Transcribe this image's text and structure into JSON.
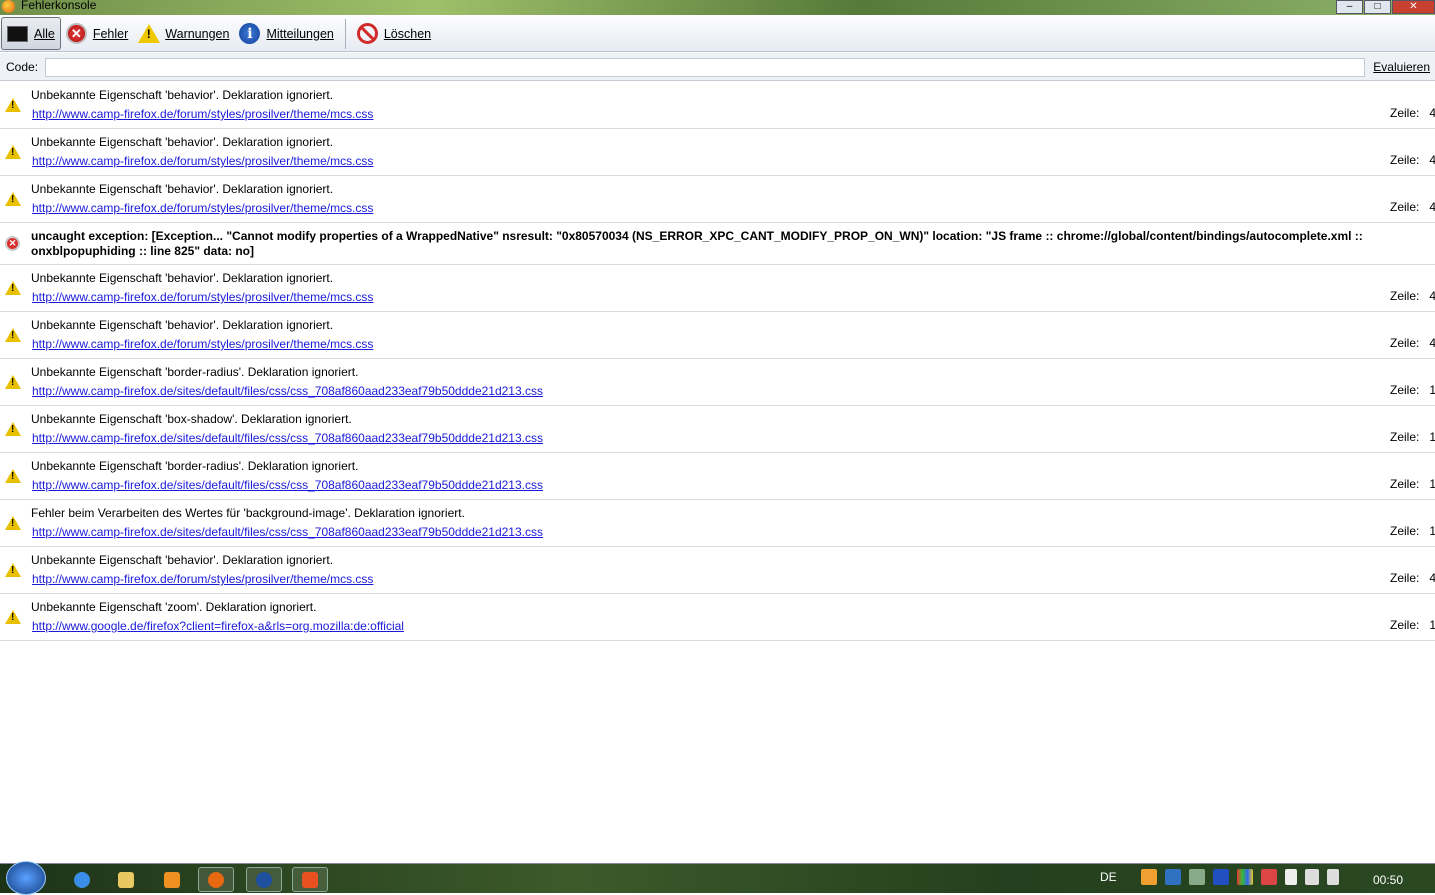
{
  "window": {
    "title": "Fehlerkonsole"
  },
  "toolbar": {
    "items": [
      {
        "label": "Alle",
        "icon": "console-icon",
        "selected": true
      },
      {
        "label": "Fehler",
        "icon": "error-icon"
      },
      {
        "label": "Warnungen",
        "icon": "warning-icon"
      },
      {
        "label": "Mitteilungen",
        "icon": "info-icon"
      },
      {
        "label": "Löschen",
        "icon": "clear-icon"
      }
    ]
  },
  "code": {
    "label": "Code:",
    "value": "",
    "evaluate_label": "Evaluieren"
  },
  "line_label": "Zeile:",
  "messages": [
    {
      "type": "warning",
      "text": "Unbekannte Eigenschaft 'behavior'.  Deklaration ignoriert.",
      "source": "http://www.camp-firefox.de/forum/styles/prosilver/theme/mcs.css",
      "line": "4"
    },
    {
      "type": "warning",
      "text": "Unbekannte Eigenschaft 'behavior'.  Deklaration ignoriert.",
      "source": "http://www.camp-firefox.de/forum/styles/prosilver/theme/mcs.css",
      "line": "4"
    },
    {
      "type": "warning",
      "text": "Unbekannte Eigenschaft 'behavior'.  Deklaration ignoriert.",
      "source": "http://www.camp-firefox.de/forum/styles/prosilver/theme/mcs.css",
      "line": "4"
    },
    {
      "type": "error",
      "text": "uncaught exception: [Exception... \"Cannot modify properties of a WrappedNative\"  nsresult: \"0x80570034 (NS_ERROR_XPC_CANT_MODIFY_PROP_ON_WN)\"  location: \"JS frame :: chrome://global/content/bindings/autocomplete.xml :: onxblpopuphiding :: line 825\"  data: no]"
    },
    {
      "type": "warning",
      "text": "Unbekannte Eigenschaft 'behavior'.  Deklaration ignoriert.",
      "source": "http://www.camp-firefox.de/forum/styles/prosilver/theme/mcs.css",
      "line": "4"
    },
    {
      "type": "warning",
      "text": "Unbekannte Eigenschaft 'behavior'.  Deklaration ignoriert.",
      "source": "http://www.camp-firefox.de/forum/styles/prosilver/theme/mcs.css",
      "line": "4"
    },
    {
      "type": "warning",
      "text": "Unbekannte Eigenschaft 'border-radius'.  Deklaration ignoriert.",
      "source": "http://www.camp-firefox.de/sites/default/files/css/css_708af860aad233eaf79b50ddde21d213.css",
      "line": "1"
    },
    {
      "type": "warning",
      "text": "Unbekannte Eigenschaft 'box-shadow'.  Deklaration ignoriert.",
      "source": "http://www.camp-firefox.de/sites/default/files/css/css_708af860aad233eaf79b50ddde21d213.css",
      "line": "1"
    },
    {
      "type": "warning",
      "text": "Unbekannte Eigenschaft 'border-radius'.  Deklaration ignoriert.",
      "source": "http://www.camp-firefox.de/sites/default/files/css/css_708af860aad233eaf79b50ddde21d213.css",
      "line": "1"
    },
    {
      "type": "warning",
      "text": "Fehler beim Verarbeiten des Wertes für 'background-image'.  Deklaration ignoriert.",
      "source": "http://www.camp-firefox.de/sites/default/files/css/css_708af860aad233eaf79b50ddde21d213.css",
      "line": "1"
    },
    {
      "type": "warning",
      "text": "Unbekannte Eigenschaft 'behavior'.  Deklaration ignoriert.",
      "source": "http://www.camp-firefox.de/forum/styles/prosilver/theme/mcs.css",
      "line": "4"
    },
    {
      "type": "warning",
      "text": "Unbekannte Eigenschaft 'zoom'.  Deklaration ignoriert.",
      "source": "http://www.google.de/firefox?client=firefox-a&rls=org.mozilla:de:official",
      "line": "1"
    }
  ],
  "taskbar": {
    "language": "DE",
    "clock": "00:50"
  }
}
